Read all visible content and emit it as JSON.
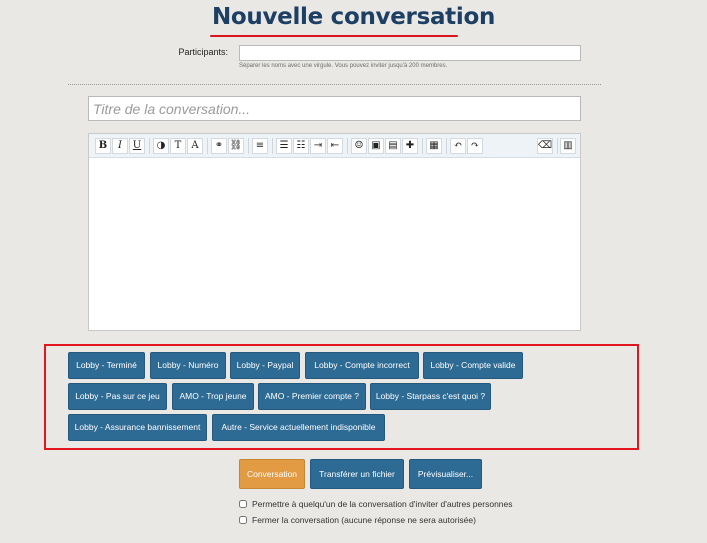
{
  "page": {
    "title": "Nouvelle conversation"
  },
  "participants": {
    "label": "Participants:",
    "value": "",
    "hint": "Séparer les noms avec une virgule. Vous pouvez inviter jusqu'à 200 membres."
  },
  "conversation": {
    "title_placeholder": "Titre de la conversation..."
  },
  "toolbar": {
    "buttons": [
      {
        "name": "bold-icon",
        "glyph": "B"
      },
      {
        "name": "italic-icon",
        "glyph": "I"
      },
      {
        "name": "underline-icon",
        "glyph": "U"
      },
      {
        "name": "color-icon",
        "glyph": "◑"
      },
      {
        "name": "font-size-icon",
        "glyph": "T"
      },
      {
        "name": "font-family-icon",
        "glyph": "A"
      },
      {
        "name": "link-icon",
        "glyph": "⚭"
      },
      {
        "name": "unlink-icon",
        "glyph": "⛓"
      },
      {
        "name": "align-icon",
        "glyph": "≡"
      },
      {
        "name": "bullet-list-icon",
        "glyph": "☰"
      },
      {
        "name": "numbered-list-icon",
        "glyph": "☷"
      },
      {
        "name": "indent-icon",
        "glyph": "⇥"
      },
      {
        "name": "outdent-icon",
        "glyph": "⇤"
      },
      {
        "name": "smiley-icon",
        "glyph": "☺"
      },
      {
        "name": "image-icon",
        "glyph": "▣"
      },
      {
        "name": "media-icon",
        "glyph": "▤"
      },
      {
        "name": "plus-icon",
        "glyph": "✚"
      },
      {
        "name": "save-draft-icon",
        "glyph": "▦"
      },
      {
        "name": "undo-icon",
        "glyph": "↶"
      },
      {
        "name": "redo-icon",
        "glyph": "↷"
      },
      {
        "name": "eraser-icon",
        "glyph": "⌫"
      },
      {
        "name": "source-icon",
        "glyph": "▥"
      }
    ]
  },
  "quick_replies": [
    "Lobby - Terminé",
    "Lobby - Numéro",
    "Lobby - Paypal",
    "Lobby - Compte incorrect",
    "Lobby - Compte valide",
    "Lobby - Pas sur ce jeu",
    "AMO - Trop jeune",
    "AMO - Premier compte ?",
    "Lobby - Starpass c'est quoi ?",
    "Lobby - Assurance bannissement",
    "Autre - Service actuellement indisponible"
  ],
  "actions": {
    "submit": "Conversation",
    "upload": "Transférer un fichier",
    "preview": "Prévisualiser..."
  },
  "options": [
    {
      "label": "Permettre à quelqu'un de la conversation d'inviter d'autres personnes",
      "checked": false
    },
    {
      "label": "Fermer la conversation (aucune réponse ne sera autorisée)",
      "checked": false
    }
  ],
  "colors": {
    "title": "#1d3f63",
    "accent_red": "#e2161c",
    "button_blue": "#2d6a94",
    "button_orange": "#e29a43"
  }
}
